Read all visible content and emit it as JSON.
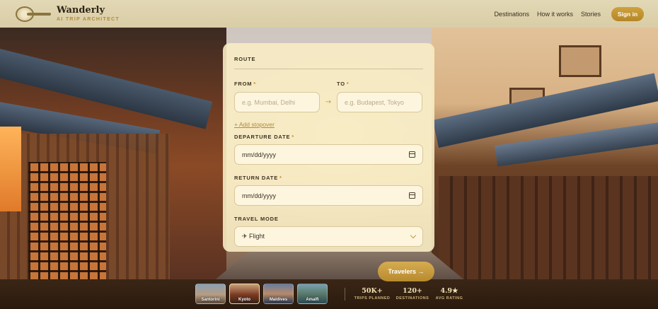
{
  "header": {
    "brand_name": "Wanderly",
    "brand_tagline": "AI TRIP ARCHITECT",
    "nav": [
      {
        "label": "Destinations"
      },
      {
        "label": "How it works"
      },
      {
        "label": "Stories"
      }
    ],
    "signin_label": "Sign in"
  },
  "form": {
    "route_title": "ROUTE",
    "from": {
      "label": "FROM",
      "required": "*",
      "placeholder": "e.g. Mumbai, Delhi"
    },
    "swap_icon": "→",
    "to": {
      "label": "TO",
      "required": "*",
      "placeholder": "e.g. Budapest, Tokyo"
    },
    "add_stopover": "+ Add stopover",
    "departure": {
      "label": "DEPARTURE DATE",
      "required": "*",
      "value": "mm/dd/yyyy"
    },
    "return": {
      "label": "RETURN DATE",
      "required": "*",
      "value": "mm/dd/yyyy"
    },
    "travel_mode": {
      "label": "TRAVEL MODE",
      "value": "✈ Flight"
    },
    "travelers_button": "Travelers →"
  },
  "destinations": [
    {
      "name": "Santorini",
      "active": false
    },
    {
      "name": "Kyoto",
      "active": true
    },
    {
      "name": "Maldives",
      "active": false
    },
    {
      "name": "Amalfi",
      "active": false
    }
  ],
  "stats": [
    {
      "value": "50K+",
      "label": "TRIPS PLANNED"
    },
    {
      "value": "120+",
      "label": "DESTINATIONS"
    },
    {
      "value": "4.9★",
      "label": "AVG RATING"
    }
  ],
  "colors": {
    "accent": "#c99a3a",
    "card": "#f7ecc4",
    "header": "#e3d8b5"
  }
}
